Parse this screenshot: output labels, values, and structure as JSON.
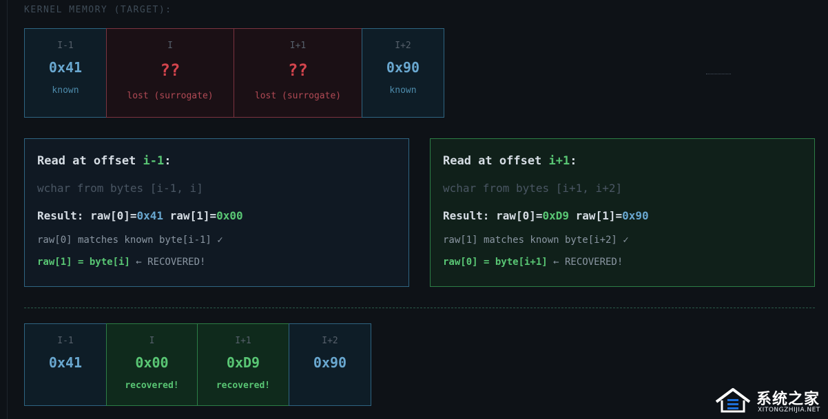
{
  "heading": "KERNEL MEMORY (TARGET):",
  "top_cells": [
    {
      "index": "I-1",
      "value": "0x41",
      "note": "known",
      "kind": "known",
      "width": 120
    },
    {
      "index": "I",
      "value": "??",
      "note": "lost (surrogate)",
      "kind": "lost",
      "width": 186
    },
    {
      "index": "I+1",
      "value": "??",
      "note": "lost (surrogate)",
      "kind": "lost",
      "width": 187
    },
    {
      "index": "I+2",
      "value": "0x90",
      "note": "known",
      "kind": "known",
      "width": 120
    }
  ],
  "panel_left": {
    "title_prefix": "Read at offset ",
    "title_offset": "i-1",
    "title_suffix": ":",
    "source": "wchar from bytes [i-1, i]",
    "result_prefix": "Result: raw[0]=",
    "raw0": "0x41",
    "result_mid": " raw[1]=",
    "raw1": "0x00",
    "match": "raw[0] matches known byte[i-1] ✓",
    "recovered_code": "raw[1] = byte[i]",
    "recovered_text": " ← RECOVERED!"
  },
  "panel_right": {
    "title_prefix": "Read at offset ",
    "title_offset": "i+1",
    "title_suffix": ":",
    "source": "wchar from bytes [i+1, i+2]",
    "result_prefix": "Result: raw[0]=",
    "raw0": "0xD9",
    "result_mid": " raw[1]=",
    "raw1": "0x90",
    "match": "raw[1] matches known byte[i+2] ✓",
    "recovered_code": "raw[0] = byte[i+1]",
    "recovered_text": " ← RECOVERED!"
  },
  "bottom_cells": [
    {
      "index": "I-1",
      "value": "0x41",
      "note": "",
      "kind": "known",
      "width": 120
    },
    {
      "index": "I",
      "value": "0x00",
      "note": "recovered!",
      "kind": "rec",
      "width": 133
    },
    {
      "index": "I+1",
      "value": "0xD9",
      "note": "recovered!",
      "kind": "rec",
      "width": 134
    },
    {
      "index": "I+2",
      "value": "0x90",
      "note": "",
      "kind": "known",
      "width": 120
    }
  ],
  "watermark": {
    "title": "系统之家",
    "subtitle": "XITONGZHIJIA.NET"
  }
}
